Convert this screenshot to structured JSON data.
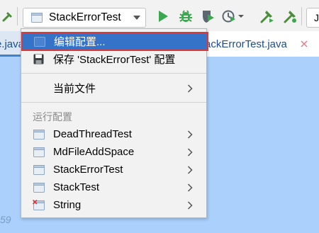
{
  "toolbar": {
    "run_config": {
      "label": "StackErrorTest",
      "icon": "run-config-icon",
      "caret_icon": "chevron-down-icon"
    },
    "icons": [
      "hammer-icon",
      "play-icon",
      "debug-icon",
      "coverage-icon",
      "profile-icon",
      "modify-icon"
    ],
    "truncated_field_text": "J"
  },
  "tabs": {
    "left_fragment": "ce.java",
    "right_label": "StackErrorTest.java",
    "right_visible_fragment": "ackErrorTest.java",
    "close_icon": "close-icon"
  },
  "editor": {
    "gutter_fragment": "59"
  },
  "menu": {
    "selected_item": {
      "label": "编辑配置..."
    },
    "save_item": {
      "label": "保存 'StackErrorTest' 配置",
      "icon": "save-icon"
    },
    "current_file": {
      "label": "当前文件"
    },
    "section_header": "运行配置",
    "configs": [
      {
        "label": "DeadThreadTest",
        "icon": "run-config-icon",
        "error": false
      },
      {
        "label": "MdFileAddSpace",
        "icon": "run-config-icon",
        "error": false
      },
      {
        "label": "StackErrorTest",
        "icon": "run-config-icon",
        "error": false
      },
      {
        "label": "StackTest",
        "icon": "run-config-icon",
        "error": false
      },
      {
        "label": "String",
        "icon": "run-config-error-icon",
        "error": true
      }
    ]
  },
  "colors": {
    "selection": "#3573c8",
    "selection_outline": "#d83b3b",
    "run_green": "#3aa84e",
    "editor_bg": "#aad0fb",
    "menu_bg": "#f2f2f2"
  }
}
